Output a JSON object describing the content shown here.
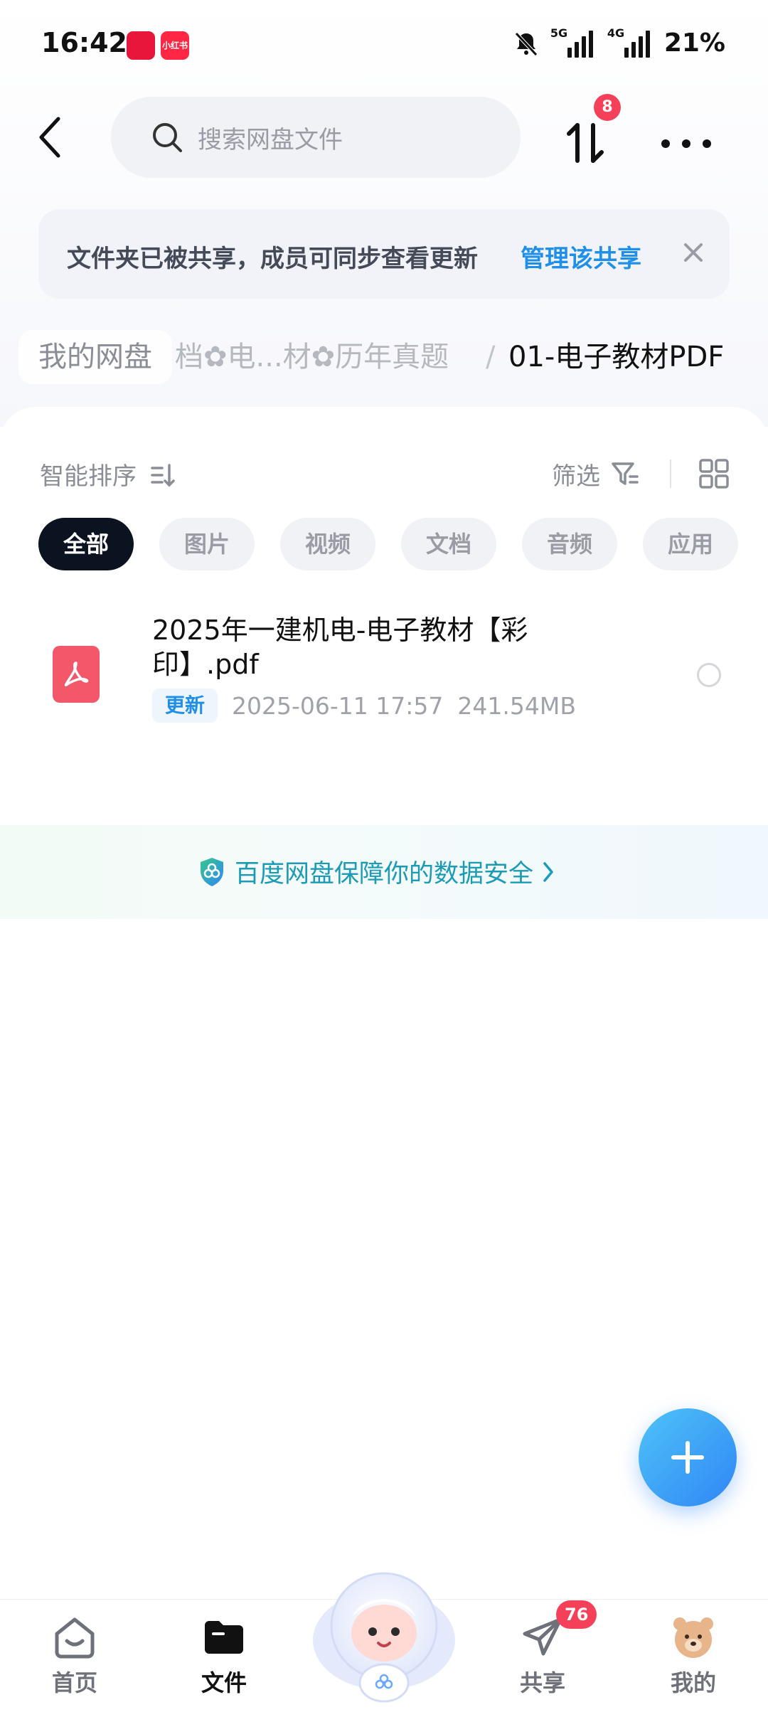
{
  "status_bar": {
    "time": "16:42",
    "app_xhs": "小红书",
    "signal_1": "5G",
    "signal_2": "4G",
    "battery": "21%"
  },
  "header": {
    "search_placeholder": "搜索网盘文件",
    "transfer_badge": "8"
  },
  "share_banner": {
    "text": "文件夹已被共享，成员可同步查看更新",
    "link": "管理该共享"
  },
  "breadcrumb": {
    "root": "我的网盘",
    "middle": "档✿电...材✿历年真题",
    "separator": "/",
    "current": "01-电子教材PDF"
  },
  "toolbar": {
    "sort_label": "智能排序",
    "filter_label": "筛选"
  },
  "tabs": [
    "全部",
    "图片",
    "视频",
    "文档",
    "音频",
    "应用"
  ],
  "files": [
    {
      "name": "2025年一建机电-电子教材【彩印】.pdf",
      "badge": "更新",
      "date": "2025-06-11  17:57",
      "size": "241.54MB"
    }
  ],
  "safety": {
    "text": "百度网盘保障你的数据安全"
  },
  "bottom_nav": {
    "home": "首页",
    "files": "文件",
    "share": "共享",
    "share_badge": "76",
    "mine": "我的"
  },
  "colors": {
    "accent": "#1f8fe8",
    "badge": "#f5405a",
    "pdf": "#f2586a",
    "active_tab": "#0b1220"
  }
}
